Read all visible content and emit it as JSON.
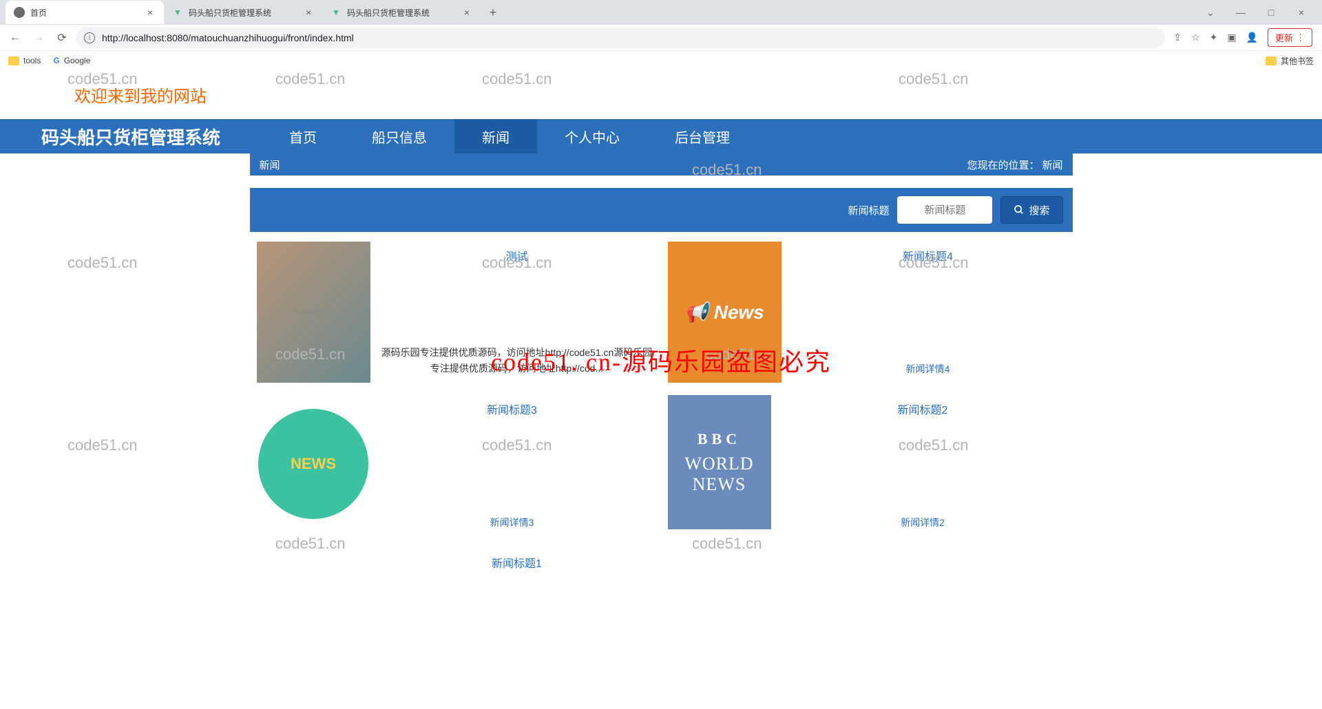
{
  "browser": {
    "tabs": [
      {
        "title": "首页",
        "icon": "globe"
      },
      {
        "title": "码头船只货柜管理系统",
        "icon": "vue"
      },
      {
        "title": "码头船只货柜管理系统",
        "icon": "vue"
      }
    ],
    "url": "http://localhost:8080/matouchuanzhihuogui/front/index.html",
    "update": "更新",
    "bookmarks": {
      "tools": "tools",
      "google": "Google",
      "other": "其他书签"
    }
  },
  "page": {
    "welcome": "欢迎来到我的网站",
    "brand": "码头船只货柜管理系统",
    "nav": [
      "首页",
      "船只信息",
      "新闻",
      "个人中心",
      "后台管理"
    ],
    "crumb": {
      "title": "新闻",
      "posLabel": "您现在的位置：",
      "posValue": "新闻"
    },
    "search": {
      "label": "新闻标题",
      "placeholder": "新闻标题",
      "btn": "搜索"
    },
    "news": [
      {
        "title": "测试",
        "desc": "源码乐园专注提供优质源码，访问地址http://code51.cn源码乐园专注提供优质源码，访问地址http://cod..."
      },
      {
        "title": "新闻标题4",
        "detail": "新闻详情4"
      },
      {
        "title": "新闻标题3",
        "detail": "新闻详情3"
      },
      {
        "title": "新闻标题2",
        "detail": "新闻详情2"
      },
      {
        "title": "新闻标题1"
      }
    ],
    "bigWatermark": "code51. cn-源码乐园盗图必究",
    "wm": "code51.cn"
  }
}
